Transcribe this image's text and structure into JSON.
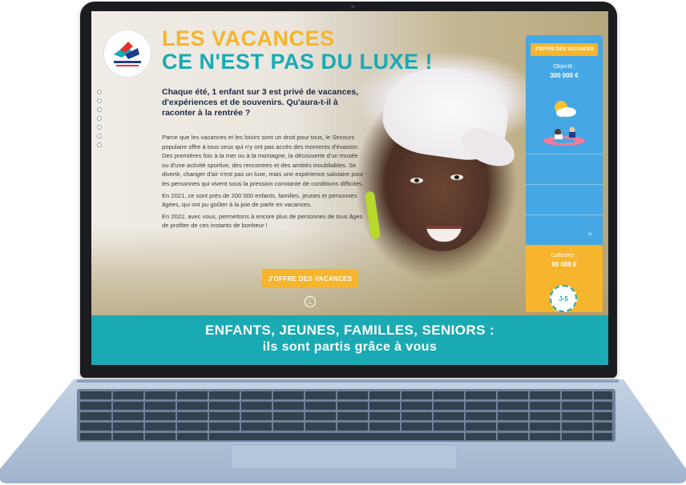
{
  "site": {
    "headline_line1": "LES VACANCES",
    "headline_line2": "CE N'EST PAS DU LUXE !",
    "intro": "Chaque été, 1 enfant sur 3 est privé de vacances, d'expériences et de souvenirs. Qu'aura-t-il à raconter à la rentrée ?",
    "paragraphs": [
      "Parce que les vacances et les loisirs sont un droit pour tous, le Secours populaire offre à tous ceux qui n'y ont pas accès des moments d'évasion. Des premières fois à la mer ou à la montagne, la découverte d'un musée ou d'une activité sportive, des rencontres et des amitiés inoubliables. Se divertir, changer d'air n'est pas un luxe, mais une expérience salutaire pour les personnes qui vivent sous la pression constante de conditions difficiles.",
      "En 2021, ce sont près de 200 000 enfants, familles, jeunes et personnes âgées, qui ont pu goûter à la joie de partir en vacances.",
      "En 2022, avec vous, permettons à encore plus de personnes de tous âges de profiter de ces instants de bonheur !"
    ],
    "cta_label": "J'OFFRE DES VACANCES"
  },
  "tracker": {
    "button_label": "J'OFFRE DES VACANCES",
    "objective_label": "Objectif :",
    "objective_value": "300 000 €",
    "collected_label": "Collectés :",
    "collected_value": "90 000 €",
    "progress_fraction": 0.3,
    "countdown": "J-5"
  },
  "banner": {
    "line1": "ENFANTS, JEUNES, FAMILLES, SENIORS :",
    "line2": "ils sont partis grâce à vous"
  },
  "colors": {
    "yellow": "#f6b52c",
    "teal": "#1aaab4",
    "sky": "#45a7e3",
    "navy": "#1f2a44"
  },
  "icons": [
    "logo-icon",
    "sun-cloud-icon",
    "swimmer-icon",
    "star-icon",
    "scroll-down-icon"
  ]
}
